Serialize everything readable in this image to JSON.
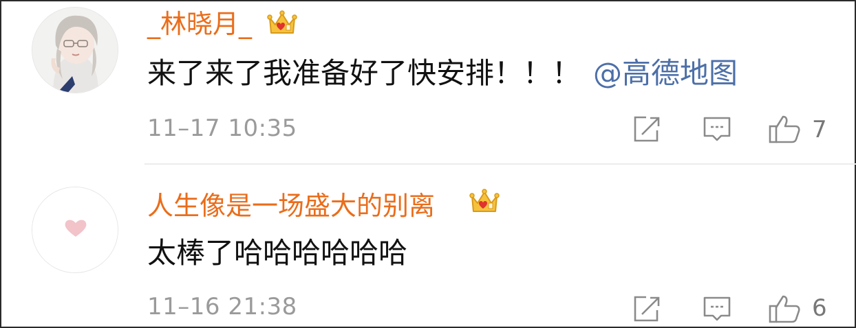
{
  "comments": [
    {
      "username": "_林晓月_",
      "content": "来了来了我准备好了快安排！！！",
      "mention": "@高德地图",
      "time": "11–17 10:35",
      "like_count": "7",
      "avatar": "avatar-girl-illustration",
      "badge": "crown-icon"
    },
    {
      "username": "人生像是一场盛大的别离",
      "content": "太棒了哈哈哈哈哈哈",
      "mention": "",
      "time": "11–16 21:38",
      "like_count": "6",
      "avatar": "avatar-pink-heart",
      "badge": "crown-icon"
    }
  ],
  "colors": {
    "username": "#ea6d1b",
    "mention": "#4c6fa8",
    "meta": "#9a9a9a",
    "icon": "#8a8a8a"
  },
  "icons": [
    "share-icon",
    "comment-icon",
    "like-icon"
  ]
}
